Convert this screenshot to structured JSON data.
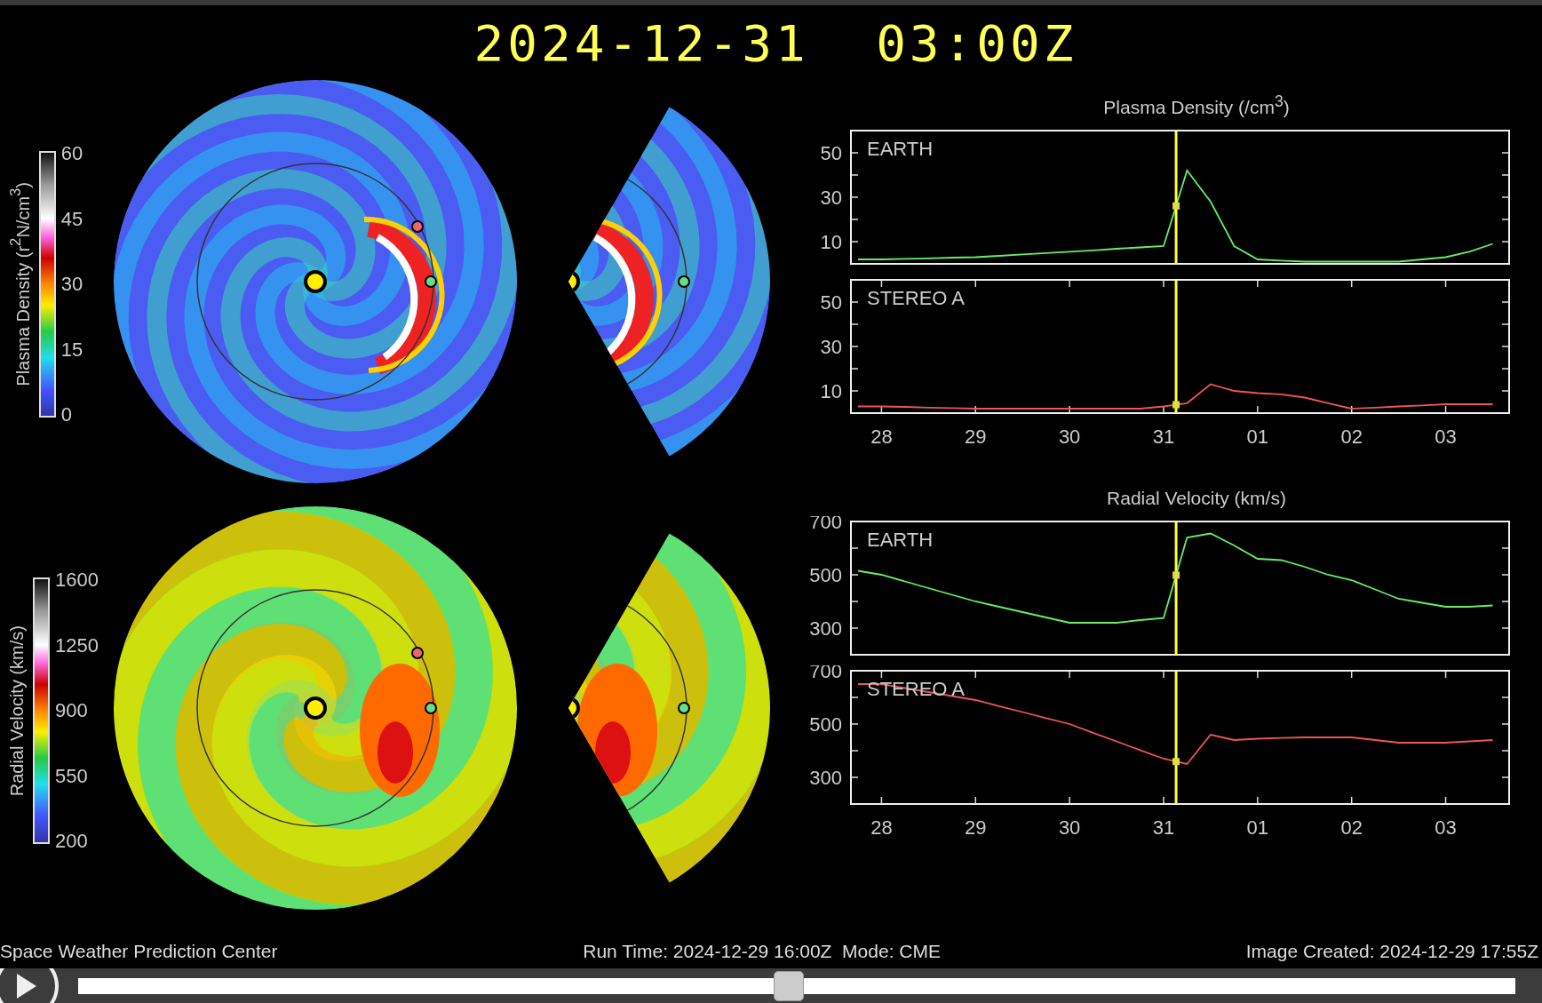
{
  "title": "2024-12-31  03:00Z",
  "maps": [
    {
      "kind": "density",
      "colorbar": {
        "label": "Plasma Density (r$^{2}$N/cm$^{3}$)",
        "ticks": [
          "60",
          "45",
          "30",
          "15",
          "0"
        ]
      }
    },
    {
      "kind": "velocity",
      "colorbar": {
        "label": "Radial Velocity (km/s)",
        "ticks": [
          "1600",
          "1250",
          "900",
          "550",
          "200"
        ]
      }
    }
  ],
  "plots": [
    {
      "title": "Plasma Density (/cm$^{3}$)",
      "panels": [
        {
          "chart_data": {
            "type": "line",
            "categories": [
              null,
              null,
              null,
              null,
              null,
              null,
              null,
              null,
              null,
              null,
              null,
              null,
              null,
              null,
              null,
              null,
              null,
              null,
              null,
              null,
              null,
              null,
              null,
              null,
              null,
              null,
              null,
              null
            ],
            "series": [
              {
                "name": "EARTH",
                "color": "#66ee66",
                "values": [
                  2,
                  2,
                  2.3,
                  2.5,
                  2.8,
                  3,
                  3.6,
                  4.3,
                  4.9,
                  5.5,
                  6.1,
                  6.8,
                  7.4,
                  8,
                  42,
                  28,
                  8,
                  2,
                  1.5,
                  1,
                  1,
                  1,
                  1,
                  1,
                  2,
                  3,
                  5.5,
                  9
                ]
              }
            ],
            "ylim": [
              0,
              60
            ],
            "yticks": [
              10,
              30,
              50
            ]
          }
        },
        {
          "chart_data": {
            "type": "line",
            "categories": [
              null,
              "28",
              null,
              null,
              null,
              "29",
              null,
              null,
              null,
              "30",
              null,
              null,
              null,
              "31",
              null,
              null,
              null,
              "01",
              null,
              null,
              null,
              "02",
              null,
              null,
              null,
              "03",
              null,
              null
            ],
            "series": [
              {
                "name": "STEREO A",
                "color": "#ee5555",
                "values": [
                  3,
                  3,
                  2.8,
                  2.5,
                  2.3,
                  2,
                  2,
                  2,
                  2,
                  2,
                  2,
                  2,
                  2,
                  3,
                  4.5,
                  13,
                  10,
                  9,
                  8.5,
                  7,
                  4.5,
                  2,
                  2.5,
                  3,
                  3.5,
                  4,
                  4,
                  4
                ]
              }
            ],
            "ylim": [
              0,
              60
            ],
            "yticks": [
              10,
              30,
              50
            ]
          }
        }
      ]
    },
    {
      "title": "Radial Velocity (km/s)",
      "panels": [
        {
          "chart_data": {
            "type": "line",
            "categories": [
              null,
              null,
              null,
              null,
              null,
              null,
              null,
              null,
              null,
              null,
              null,
              null,
              null,
              null,
              null,
              null,
              null,
              null,
              null,
              null,
              null,
              null,
              null,
              null,
              null,
              null,
              null,
              null
            ],
            "series": [
              {
                "name": "EARTH",
                "color": "#66ee66",
                "values": [
                  515,
                  500,
                  475,
                  450,
                  425,
                  400,
                  380,
                  360,
                  340,
                  320,
                  320,
                  320,
                  330,
                  338,
                  640,
                  655,
                  610,
                  560,
                  555,
                  530,
                  500,
                  480,
                  445,
                  410,
                  395,
                  380,
                  380,
                  385
                ]
              }
            ],
            "ylim": [
              200,
              700
            ],
            "yticks": [
              300,
              500,
              700
            ]
          }
        },
        {
          "chart_data": {
            "type": "line",
            "categories": [
              null,
              "28",
              null,
              null,
              null,
              "29",
              null,
              null,
              null,
              "30",
              null,
              null,
              null,
              "31",
              null,
              null,
              null,
              "01",
              null,
              null,
              null,
              "02",
              null,
              null,
              null,
              "03",
              null,
              null
            ],
            "series": [
              {
                "name": "STEREO A",
                "color": "#ee5555",
                "values": [
                  650,
                  650,
                  635,
                  620,
                  605,
                  590,
                  567,
                  545,
                  522,
                  500,
                  467,
                  435,
                  402,
                  370,
                  350,
                  460,
                  440,
                  445,
                  448,
                  450,
                  450,
                  450,
                  440,
                  430,
                  430,
                  430,
                  435,
                  440
                ]
              }
            ],
            "ylim": [
              200,
              700
            ],
            "yticks": [
              300,
              500,
              700
            ]
          }
        }
      ]
    }
  ],
  "footer": {
    "left": "Space Weather Prediction Center",
    "center": "Run Time: 2024-12-29 16:00Z  Mode: CME",
    "right": "Image Created: 2024-12-29 17:55Z"
  },
  "player": {
    "level": 0.494
  }
}
